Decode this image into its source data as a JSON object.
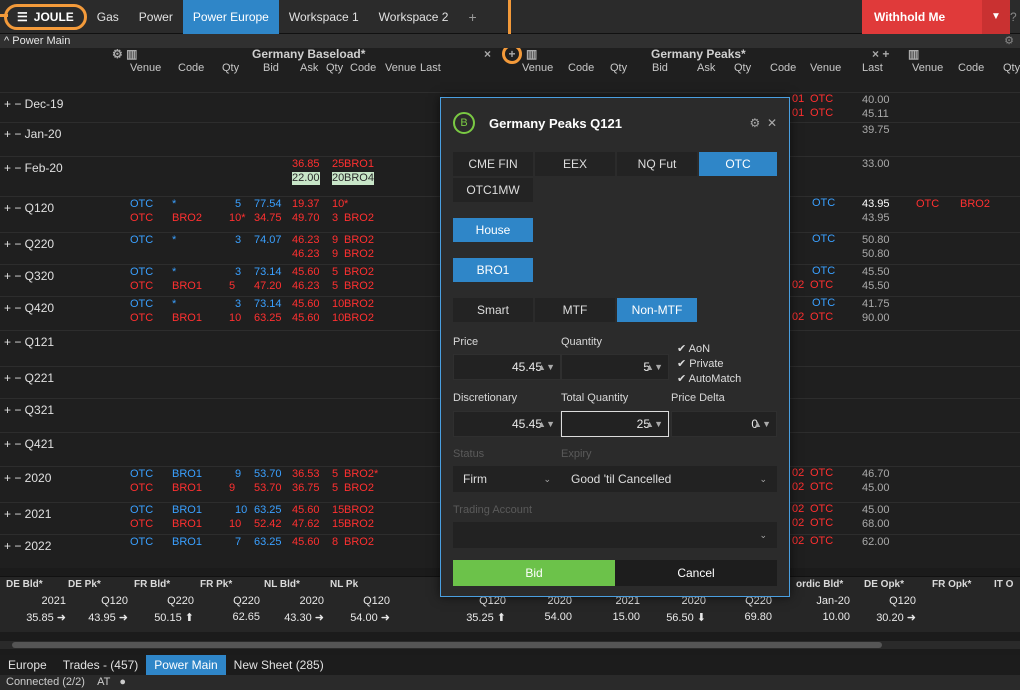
{
  "app": {
    "logo": "JOULE",
    "tabs": [
      "Gas",
      "Power",
      "Power Europe",
      "Workspace 1",
      "Workspace 2"
    ],
    "active_tab": "Power Europe",
    "plus": "+",
    "withhold_label": "Withhold Me",
    "help": "?"
  },
  "section": {
    "title": "Power Main"
  },
  "groups": {
    "left": "Germany Baseload*",
    "right": "Germany Peaks*"
  },
  "columns": {
    "left": [
      "Venue",
      "Code",
      "Qty",
      "Bid",
      "Ask",
      "Qty",
      "Code",
      "Venue",
      "Last"
    ],
    "right": [
      "Venue",
      "Code",
      "Qty",
      "Bid",
      "Ask",
      "Qty",
      "Code",
      "Venue",
      "Last",
      "Venue",
      "Code",
      "Qty"
    ]
  },
  "rows": [
    {
      "label": "Dec-19",
      "last2": "40.00",
      "last2b": "45.11"
    },
    {
      "label": "Jan-20",
      "last2": "39.75"
    },
    {
      "label": "Feb-20",
      "ask": "36.85",
      "aqty": "25",
      "acode": "BRO1",
      "ask_b": "22.00",
      "aqty_b": "20",
      "acode_b": "BRO4",
      "last2": "33.00"
    },
    {
      "label": "Q120",
      "venue": "OTC",
      "code": "*",
      "qty": "5",
      "bid": "77.54",
      "ask": "19.37",
      "aqty": "10",
      "acode": "*",
      "venue_b": "OTC",
      "code_b": "BRO2",
      "qty_b": "10*",
      "bid_b": "34.75",
      "ask_b": "49.70",
      "aqty_b": "3",
      "acode_b": "BRO2",
      "last2": "43.95",
      "last2b": "43.95",
      "x_venue": "OTC",
      "x_code": "BRO2"
    },
    {
      "label": "Q220",
      "venue": "OTC",
      "code": "*",
      "qty": "3",
      "bid": "74.07",
      "ask": "46.23",
      "aqty": "9",
      "acode": "BRO2",
      "ask_b": "46.23",
      "aqty_b": "9",
      "acode_b": "BRO2",
      "last2": "50.80",
      "last2b": "50.80"
    },
    {
      "label": "Q320",
      "venue": "OTC",
      "code": "*",
      "qty": "3",
      "bid": "73.14",
      "ask": "45.60",
      "aqty": "5",
      "acode": "BRO2",
      "venue_b": "OTC",
      "code_b": "BRO1",
      "qty_b": "5",
      "bid_b": "47.20",
      "ask_b": "46.23",
      "aqty_b": "5",
      "acode_b": "BRO2",
      "last2": "45.50",
      "last2b": "45.50"
    },
    {
      "label": "Q420",
      "venue": "OTC",
      "code": "*",
      "qty": "3",
      "bid": "73.14",
      "ask": "45.60",
      "aqty": "10",
      "acode": "BRO2",
      "venue_b": "OTC",
      "code_b": "BRO1",
      "qty_b": "10",
      "bid_b": "63.25",
      "ask_b": "45.60",
      "aqty_b": "10",
      "acode_b": "BRO2",
      "last2": "41.75",
      "last2b": "90.00"
    },
    {
      "label": "Q121"
    },
    {
      "label": "Q221"
    },
    {
      "label": "Q321"
    },
    {
      "label": "Q421"
    },
    {
      "label": "2020",
      "venue": "OTC",
      "code": "BRO1",
      "qty": "9",
      "bid": "53.70",
      "ask": "36.53",
      "aqty": "5",
      "acode": "BRO2*",
      "venue_b": "OTC",
      "code_b": "BRO1",
      "qty_b": "9",
      "bid_b": "53.70",
      "ask_b": "36.75",
      "aqty_b": "5",
      "acode_b": "BRO2",
      "last2": "46.70",
      "last2b": "45.00"
    },
    {
      "label": "2021",
      "venue": "OTC",
      "code": "BRO1",
      "qty": "10",
      "bid": "63.25",
      "ask": "45.60",
      "aqty": "15",
      "acode": "BRO2",
      "venue_b": "OTC",
      "code_b": "BRO1",
      "qty_b": "10",
      "bid_b": "52.42",
      "ask_b": "47.62",
      "aqty_b": "15",
      "acode_b": "BRO2",
      "last2": "45.00",
      "last2b": "68.00"
    },
    {
      "label": "2022",
      "venue": "OTC",
      "code": "BRO1",
      "qty": "7",
      "bid": "63.25",
      "ask": "45.60",
      "aqty": "8",
      "acode": "BRO2",
      "last2": "62.00"
    }
  ],
  "partial": {
    "r0": "01",
    "r0v": "OTC",
    "r0b": "01",
    "r0bv": "OTC",
    "r5": "02",
    "r5v": "OTC",
    "r7": "02",
    "r7v": "OTC",
    "r11": "02",
    "r11v": "OTC",
    "r11b": "02",
    "r11bv": "OTC",
    "r12": "02",
    "r12v": "OTC",
    "r12b": "02",
    "r12bv": "OTC",
    "r13": "02",
    "r13v": "OTC"
  },
  "summary": {
    "headers": [
      "DE Bld*",
      "DE Pk*",
      "FR Bld*",
      "FR Pk*",
      "NL Bld*",
      "NL Pk",
      "",
      "",
      "",
      "",
      "",
      "ordic Bld*",
      "DE Opk*",
      "FR Opk*",
      "IT O"
    ],
    "periods": [
      "2021",
      "Q120",
      "Q220",
      "Q220",
      "2020",
      "Q120",
      "Q120",
      "2020",
      "2021",
      "2020",
      "Q220",
      "Jan-20",
      "Q120"
    ],
    "values": [
      "35.85 ➜",
      "43.95 ➜",
      "50.15 ⬆",
      "62.65",
      "43.30 ➜",
      "54.00 ➜",
      "35.25 ⬆",
      "54.00",
      "15.00",
      "56.50 ⬇",
      "69.80",
      "10.00",
      "30.20 ➜"
    ]
  },
  "sheets": [
    "Europe",
    "Trades - (457)",
    "Power Main",
    "New Sheet (285)"
  ],
  "active_sheet": "Power Main",
  "status": {
    "connected": "Connected (2/2)",
    "at": "AT"
  },
  "modal": {
    "badge": "B",
    "title": "Germany Peaks Q121",
    "venues": [
      "CME FIN",
      "EEX",
      "NQ Fut",
      "OTC",
      "OTC1MW"
    ],
    "selected_venue": "OTC",
    "house": "House",
    "broker": "BRO1",
    "modes": [
      "Smart",
      "MTF",
      "Non-MTF"
    ],
    "selected_mode": "Non-MTF",
    "price_label": "Price",
    "price_value": "45.45",
    "quantity_label": "Quantity",
    "quantity_value": "5",
    "checks": [
      "AoN",
      "Private",
      "AutoMatch"
    ],
    "discretionary_label": "Discretionary",
    "discretionary_value": "45.45",
    "total_qty_label": "Total Quantity",
    "total_qty_value": "25",
    "price_delta_label": "Price Delta",
    "price_delta_value": "0",
    "status_label": "Status",
    "expiry_label": "Expiry",
    "status_value": "Firm",
    "expiry_value": "Good 'til Cancelled",
    "trading_account_label": "Trading Account",
    "trading_account_value": "",
    "bid_label": "Bid",
    "cancel_label": "Cancel"
  }
}
